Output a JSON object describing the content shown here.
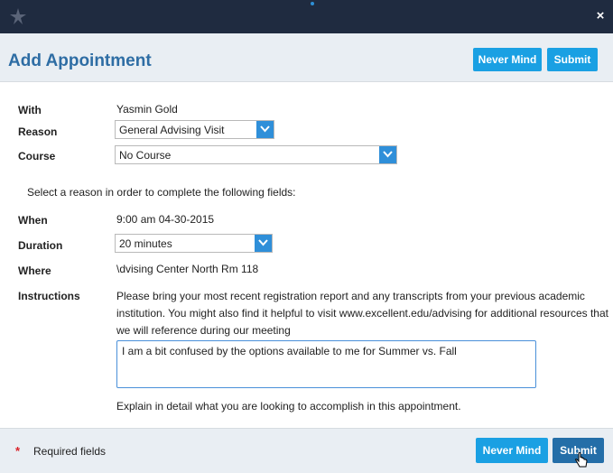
{
  "window": {
    "close_glyph": "×"
  },
  "header": {
    "title": "Add Appointment",
    "never_mind_label": "Never Mind",
    "submit_label": "Submit"
  },
  "form": {
    "with_label": "With",
    "with_value": "Yasmin Gold",
    "reason_label": "Reason",
    "reason_value": "General Advising Visit",
    "course_label": "Course",
    "course_value": "No Course",
    "select_prompt": "Select a reason in order to complete the following fields:",
    "when_label": "When",
    "when_value": "9:00 am 04-30-2015",
    "duration_label": "Duration",
    "duration_value": "20 minutes",
    "where_label": "Where",
    "where_value": "\\dvising Center North Rm 118",
    "instructions_label": "Instructions",
    "instructions_text": "Please bring your most recent registration report and any transcripts from your previous academic institution. You might also find it helpful to visit www.excellent.edu/advising for additional resources that we will reference during our meeting",
    "notes_value": "I am a bit confused by the options available to me for Summer vs. Fall",
    "notes_hint": "Explain in detail what you are looking to accomplish in this appointment."
  },
  "footer": {
    "required_star": "*",
    "required_text": "Required fields",
    "never_mind_label": "Never Mind",
    "submit_label": "Submit"
  },
  "colors": {
    "accent": "#1aa0e3",
    "accent_dark": "#246ea8",
    "title": "#2e6da4",
    "topbar": "#1f2b40",
    "required": "#d9232a"
  }
}
